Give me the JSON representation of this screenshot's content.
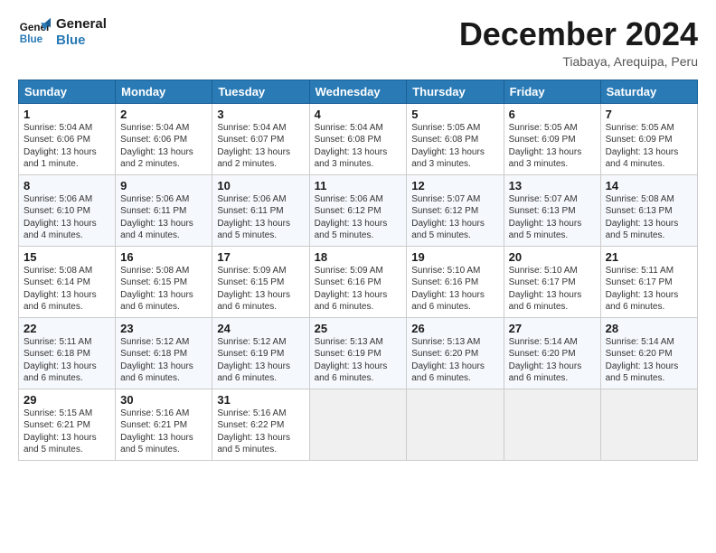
{
  "logo": {
    "line1": "General",
    "line2": "Blue"
  },
  "title": "December 2024",
  "location": "Tiabaya, Arequipa, Peru",
  "weekdays": [
    "Sunday",
    "Monday",
    "Tuesday",
    "Wednesday",
    "Thursday",
    "Friday",
    "Saturday"
  ],
  "weeks": [
    [
      {
        "day": "1",
        "detail": "Sunrise: 5:04 AM\nSunset: 6:06 PM\nDaylight: 13 hours\nand 1 minute."
      },
      {
        "day": "2",
        "detail": "Sunrise: 5:04 AM\nSunset: 6:06 PM\nDaylight: 13 hours\nand 2 minutes."
      },
      {
        "day": "3",
        "detail": "Sunrise: 5:04 AM\nSunset: 6:07 PM\nDaylight: 13 hours\nand 2 minutes."
      },
      {
        "day": "4",
        "detail": "Sunrise: 5:04 AM\nSunset: 6:08 PM\nDaylight: 13 hours\nand 3 minutes."
      },
      {
        "day": "5",
        "detail": "Sunrise: 5:05 AM\nSunset: 6:08 PM\nDaylight: 13 hours\nand 3 minutes."
      },
      {
        "day": "6",
        "detail": "Sunrise: 5:05 AM\nSunset: 6:09 PM\nDaylight: 13 hours\nand 3 minutes."
      },
      {
        "day": "7",
        "detail": "Sunrise: 5:05 AM\nSunset: 6:09 PM\nDaylight: 13 hours\nand 4 minutes."
      }
    ],
    [
      {
        "day": "8",
        "detail": "Sunrise: 5:06 AM\nSunset: 6:10 PM\nDaylight: 13 hours\nand 4 minutes."
      },
      {
        "day": "9",
        "detail": "Sunrise: 5:06 AM\nSunset: 6:11 PM\nDaylight: 13 hours\nand 4 minutes."
      },
      {
        "day": "10",
        "detail": "Sunrise: 5:06 AM\nSunset: 6:11 PM\nDaylight: 13 hours\nand 5 minutes."
      },
      {
        "day": "11",
        "detail": "Sunrise: 5:06 AM\nSunset: 6:12 PM\nDaylight: 13 hours\nand 5 minutes."
      },
      {
        "day": "12",
        "detail": "Sunrise: 5:07 AM\nSunset: 6:12 PM\nDaylight: 13 hours\nand 5 minutes."
      },
      {
        "day": "13",
        "detail": "Sunrise: 5:07 AM\nSunset: 6:13 PM\nDaylight: 13 hours\nand 5 minutes."
      },
      {
        "day": "14",
        "detail": "Sunrise: 5:08 AM\nSunset: 6:13 PM\nDaylight: 13 hours\nand 5 minutes."
      }
    ],
    [
      {
        "day": "15",
        "detail": "Sunrise: 5:08 AM\nSunset: 6:14 PM\nDaylight: 13 hours\nand 6 minutes."
      },
      {
        "day": "16",
        "detail": "Sunrise: 5:08 AM\nSunset: 6:15 PM\nDaylight: 13 hours\nand 6 minutes."
      },
      {
        "day": "17",
        "detail": "Sunrise: 5:09 AM\nSunset: 6:15 PM\nDaylight: 13 hours\nand 6 minutes."
      },
      {
        "day": "18",
        "detail": "Sunrise: 5:09 AM\nSunset: 6:16 PM\nDaylight: 13 hours\nand 6 minutes."
      },
      {
        "day": "19",
        "detail": "Sunrise: 5:10 AM\nSunset: 6:16 PM\nDaylight: 13 hours\nand 6 minutes."
      },
      {
        "day": "20",
        "detail": "Sunrise: 5:10 AM\nSunset: 6:17 PM\nDaylight: 13 hours\nand 6 minutes."
      },
      {
        "day": "21",
        "detail": "Sunrise: 5:11 AM\nSunset: 6:17 PM\nDaylight: 13 hours\nand 6 minutes."
      }
    ],
    [
      {
        "day": "22",
        "detail": "Sunrise: 5:11 AM\nSunset: 6:18 PM\nDaylight: 13 hours\nand 6 minutes."
      },
      {
        "day": "23",
        "detail": "Sunrise: 5:12 AM\nSunset: 6:18 PM\nDaylight: 13 hours\nand 6 minutes."
      },
      {
        "day": "24",
        "detail": "Sunrise: 5:12 AM\nSunset: 6:19 PM\nDaylight: 13 hours\nand 6 minutes."
      },
      {
        "day": "25",
        "detail": "Sunrise: 5:13 AM\nSunset: 6:19 PM\nDaylight: 13 hours\nand 6 minutes."
      },
      {
        "day": "26",
        "detail": "Sunrise: 5:13 AM\nSunset: 6:20 PM\nDaylight: 13 hours\nand 6 minutes."
      },
      {
        "day": "27",
        "detail": "Sunrise: 5:14 AM\nSunset: 6:20 PM\nDaylight: 13 hours\nand 6 minutes."
      },
      {
        "day": "28",
        "detail": "Sunrise: 5:14 AM\nSunset: 6:20 PM\nDaylight: 13 hours\nand 5 minutes."
      }
    ],
    [
      {
        "day": "29",
        "detail": "Sunrise: 5:15 AM\nSunset: 6:21 PM\nDaylight: 13 hours\nand 5 minutes."
      },
      {
        "day": "30",
        "detail": "Sunrise: 5:16 AM\nSunset: 6:21 PM\nDaylight: 13 hours\nand 5 minutes."
      },
      {
        "day": "31",
        "detail": "Sunrise: 5:16 AM\nSunset: 6:22 PM\nDaylight: 13 hours\nand 5 minutes."
      },
      {
        "day": "",
        "detail": ""
      },
      {
        "day": "",
        "detail": ""
      },
      {
        "day": "",
        "detail": ""
      },
      {
        "day": "",
        "detail": ""
      }
    ]
  ]
}
